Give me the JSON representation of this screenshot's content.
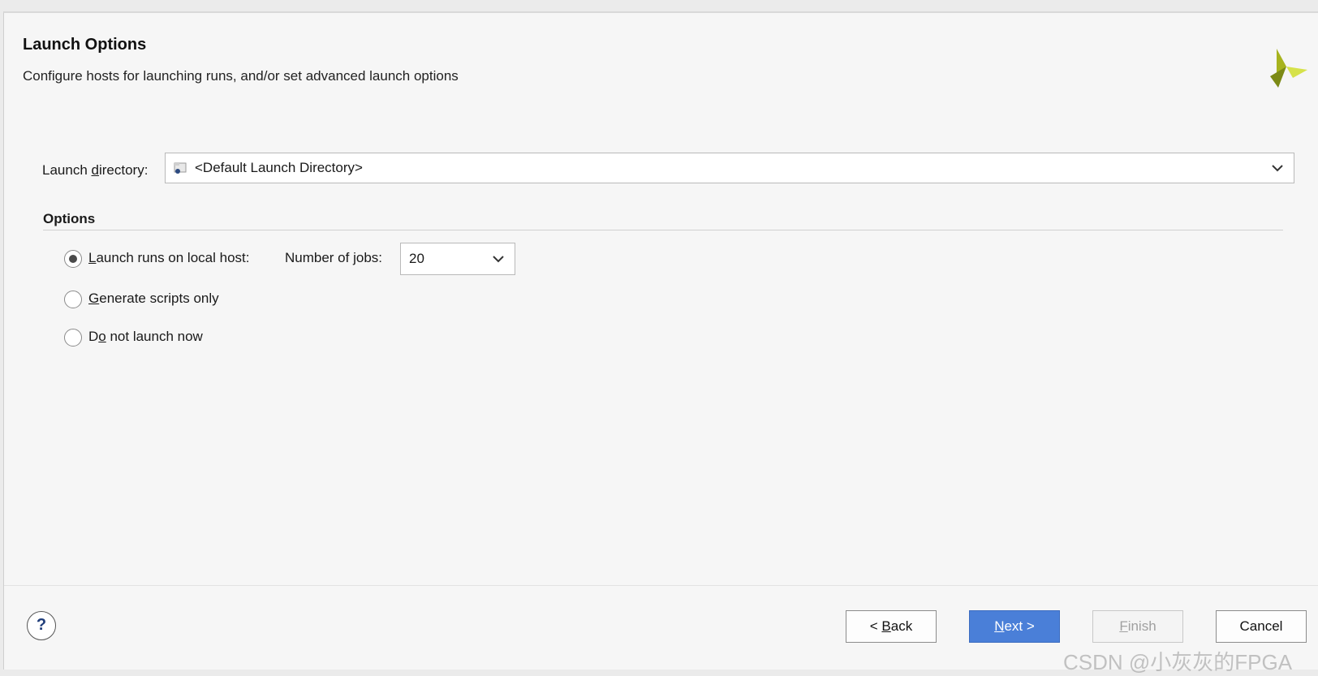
{
  "header": {
    "title": "Launch Options",
    "description": "Configure hosts for launching runs, and/or set advanced launch options"
  },
  "launch_directory": {
    "label_pre": "Launch ",
    "label_mnemonic": "d",
    "label_post": "irectory:",
    "value": "<Default Launch Directory>"
  },
  "options": {
    "title": "Options",
    "local": {
      "mnemonic": "L",
      "rest": "aunch runs on local host:",
      "selected": true
    },
    "jobs": {
      "label_pre": "Number of ",
      "label_mnemonic": "j",
      "label_post": "obs:",
      "value": "20"
    },
    "scripts": {
      "mnemonic": "G",
      "rest": "enerate scripts only",
      "selected": false
    },
    "no_launch": {
      "pre": "D",
      "mnemonic": "o",
      "rest": " not launch now",
      "selected": false
    }
  },
  "footer": {
    "help": "?",
    "back": {
      "pre": "< ",
      "mnemonic": "B",
      "rest": "ack"
    },
    "next": {
      "mnemonic": "N",
      "rest": "ext >"
    },
    "finish": {
      "mnemonic": "F",
      "rest": "inish"
    },
    "cancel": "Cancel"
  },
  "watermark": "CSDN @小灰灰的FPGA",
  "colors": {
    "primary_button": "#4a7fd8",
    "logo_dark": "#8a9a1a",
    "logo_light": "#d6e24a"
  }
}
